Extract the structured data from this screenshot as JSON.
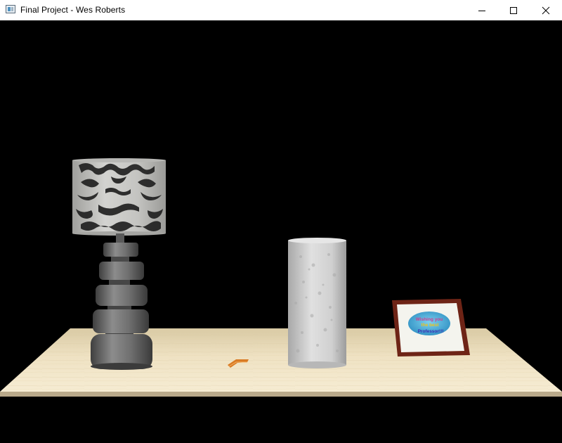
{
  "window": {
    "title": "Final Project - Wes Roberts",
    "controls": {
      "minimize_icon": "minimize-icon",
      "maximize_icon": "maximize-icon",
      "close_icon": "close-icon"
    }
  },
  "scene": {
    "background_color": "#000000",
    "table_color": "#f1e5c8",
    "objects": {
      "lamp": {
        "shade_color": "#c9c9c6",
        "base_color": "#6a6a6a"
      },
      "cylinder_color": "#d2d2d2",
      "frame": {
        "frame_color": "#6e2416",
        "text_lines": [
          "Wishing you",
          "the best",
          "Professor!!!"
        ]
      },
      "small_item_color": "#d97b24"
    }
  }
}
